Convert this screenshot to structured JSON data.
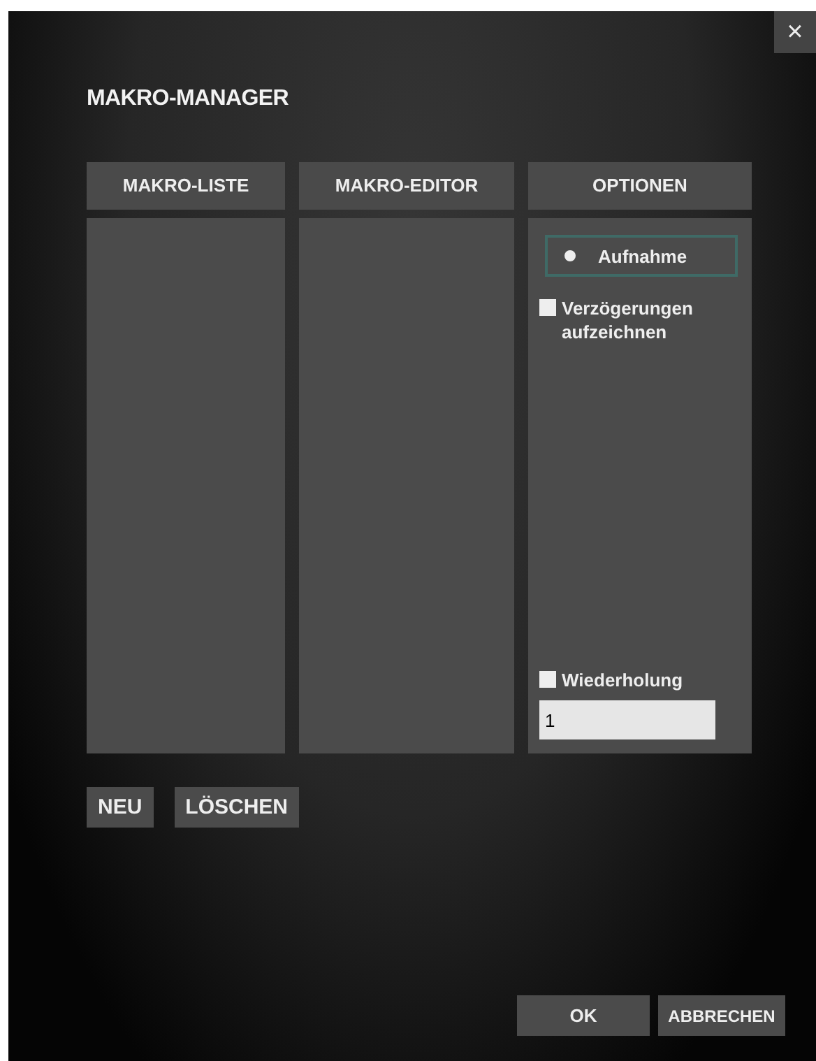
{
  "window": {
    "title": "MAKRO-MANAGER",
    "close": "×"
  },
  "columns": [
    {
      "title": "MAKRO-LISTE"
    },
    {
      "title": "MAKRO-EDITOR"
    },
    {
      "title": "OPTIONEN"
    }
  ],
  "options": {
    "record": {
      "label": "Aufnahme",
      "selected": true
    },
    "delays": {
      "label": "Verzögerungen aufzeichnen",
      "checked": false
    },
    "repeat": {
      "label": "Wiederholung",
      "checked": false,
      "value": "1"
    }
  },
  "list_buttons": [
    "NEU",
    "LÖSCHEN"
  ],
  "dialog_buttons": [
    "OK",
    "ABBRECHEN"
  ]
}
